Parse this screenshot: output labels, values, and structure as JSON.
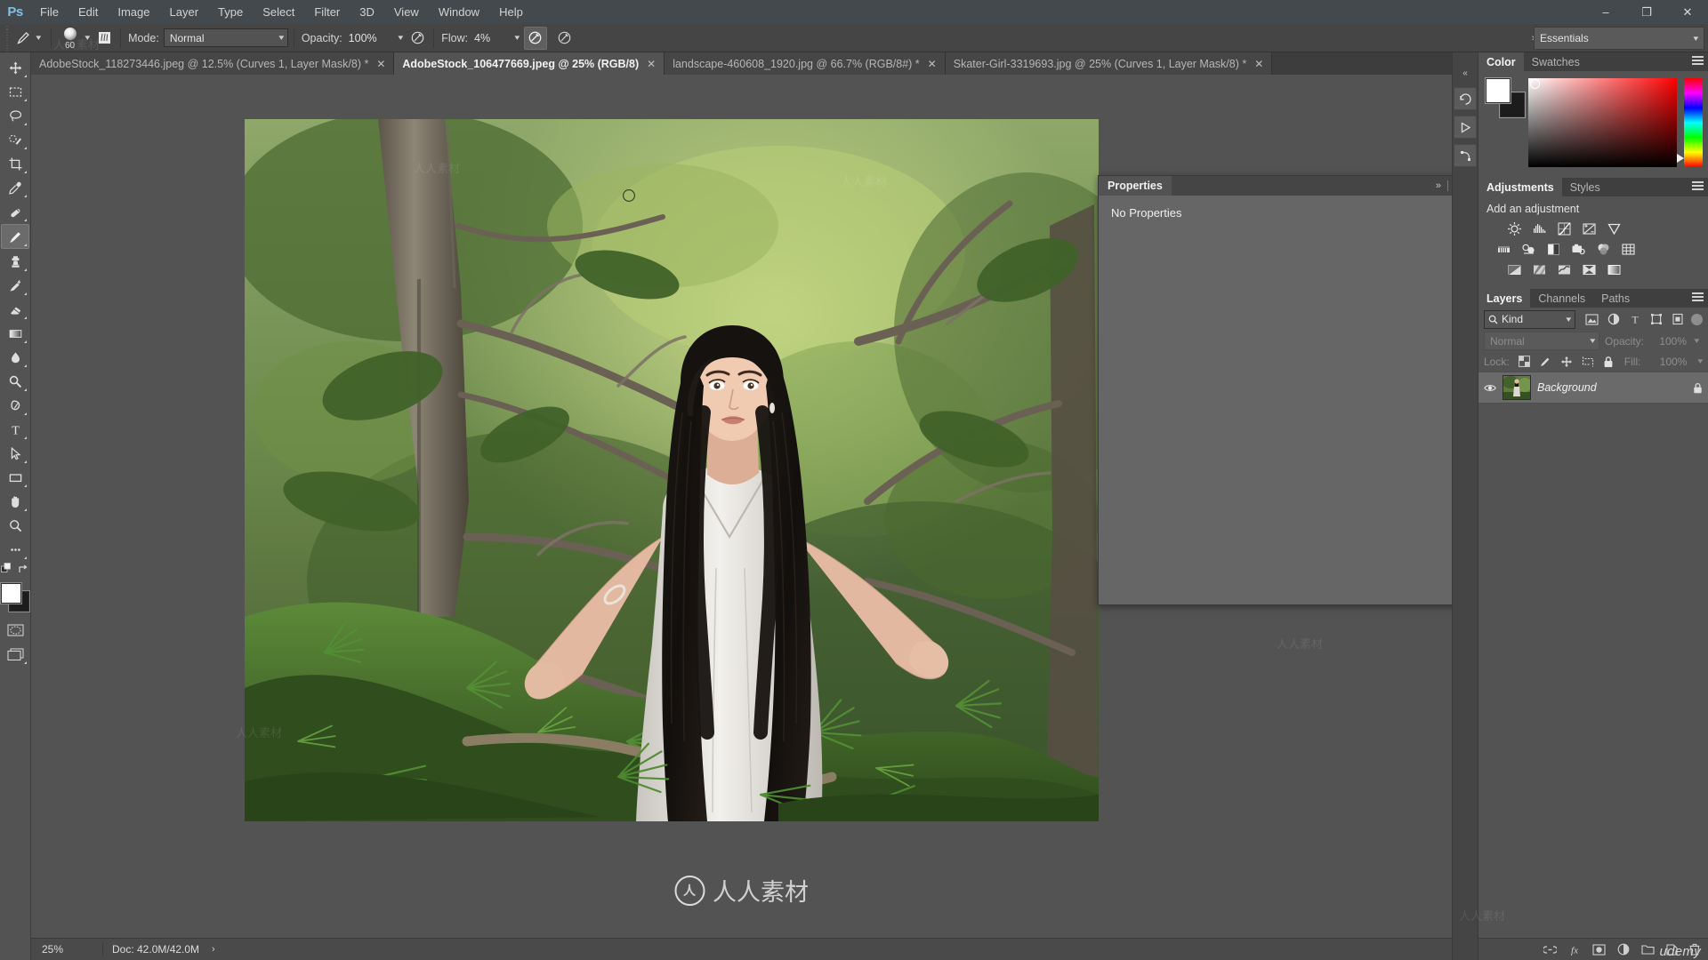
{
  "app": {
    "name": "Adobe Photoshop",
    "logo_text": "Ps"
  },
  "menubar": {
    "items": [
      {
        "label": "File"
      },
      {
        "label": "Edit"
      },
      {
        "label": "Image"
      },
      {
        "label": "Layer"
      },
      {
        "label": "Type"
      },
      {
        "label": "Select"
      },
      {
        "label": "Filter"
      },
      {
        "label": "3D"
      },
      {
        "label": "View"
      },
      {
        "label": "Window"
      },
      {
        "label": "Help"
      }
    ],
    "window_controls": {
      "minimize": "–",
      "maximize": "❐",
      "close": "✕"
    }
  },
  "options_bar": {
    "tool": "brush-tool",
    "brush_size": "60",
    "mode_label": "Mode:",
    "mode_value": "Normal",
    "opacity_label": "Opacity:",
    "opacity_value": "100%",
    "flow_label": "Flow:",
    "flow_value": "4%",
    "airbrush_icon": "airbrush-icon",
    "smoothing_icon": "tablet-pressure-icon",
    "workspace": "Essentials",
    "expand_chevrons": "»"
  },
  "document_tabs": [
    {
      "label": "AdobeStock_118273446.jpeg @ 12.5% (Curves 1, Layer Mask/8) *",
      "active": false,
      "close": "✕"
    },
    {
      "label": "AdobeStock_106477669.jpeg @ 25% (RGB/8)",
      "active": true,
      "close": "✕"
    },
    {
      "label": "landscape-460608_1920.jpg @ 66.7% (RGB/8#) *",
      "active": false,
      "close": "✕"
    },
    {
      "label": "Skater-Girl-3319693.jpg @ 25% (Curves 1, Layer Mask/8) *",
      "active": false,
      "close": "✕"
    }
  ],
  "toolbar": {
    "tools": [
      {
        "name": "move-tool",
        "selected": false
      },
      {
        "name": "rectangular-marquee-tool",
        "selected": false
      },
      {
        "name": "lasso-tool",
        "selected": false
      },
      {
        "name": "quick-selection-tool",
        "selected": false
      },
      {
        "name": "crop-tool",
        "selected": false
      },
      {
        "name": "eyedropper-tool",
        "selected": false
      },
      {
        "name": "spot-healing-brush-tool",
        "selected": false
      },
      {
        "name": "brush-tool",
        "selected": true
      },
      {
        "name": "clone-stamp-tool",
        "selected": false
      },
      {
        "name": "history-brush-tool",
        "selected": false
      },
      {
        "name": "eraser-tool",
        "selected": false
      },
      {
        "name": "gradient-tool",
        "selected": false
      },
      {
        "name": "blur-tool",
        "selected": false
      },
      {
        "name": "dodge-tool",
        "selected": false
      },
      {
        "name": "pen-tool",
        "selected": false
      },
      {
        "name": "horizontal-type-tool",
        "selected": false
      },
      {
        "name": "path-selection-tool",
        "selected": false
      },
      {
        "name": "rectangle-tool",
        "selected": false
      },
      {
        "name": "hand-tool",
        "selected": false
      },
      {
        "name": "zoom-tool",
        "selected": false
      },
      {
        "name": "edit-toolbar-tool",
        "selected": false
      }
    ],
    "foreground_color": "#ffffff",
    "background_color": "#1d1d1d",
    "quick_mask_icon": "quick-mask-icon",
    "screen_mode_icon": "screen-mode-icon"
  },
  "properties_panel": {
    "tab_label": "Properties",
    "body_text": "No Properties",
    "collapse_icon": "»",
    "menu_icon": "panel-menu-icon"
  },
  "icon_dock": {
    "buttons": [
      {
        "name": "history-dock-icon"
      },
      {
        "name": "actions-dock-icon"
      },
      {
        "name": "paths-dock-icon"
      }
    ],
    "expand_icon": "«"
  },
  "color_panel": {
    "tabs": [
      {
        "label": "Color",
        "active": true
      },
      {
        "label": "Swatches",
        "active": false
      }
    ],
    "foreground_color": "#ffffff",
    "background_color": "#1c1c1c",
    "menu_icon": "panel-menu-icon"
  },
  "adjustments_panel": {
    "tabs": [
      {
        "label": "Adjustments",
        "active": true
      },
      {
        "label": "Styles",
        "active": false
      }
    ],
    "heading": "Add an adjustment",
    "row1": [
      {
        "name": "brightness-contrast-icon"
      },
      {
        "name": "levels-icon"
      },
      {
        "name": "curves-icon"
      },
      {
        "name": "exposure-icon"
      },
      {
        "name": "vibrance-icon"
      }
    ],
    "row2": [
      {
        "name": "hue-saturation-icon"
      },
      {
        "name": "color-balance-icon"
      },
      {
        "name": "black-white-icon"
      },
      {
        "name": "photo-filter-icon"
      },
      {
        "name": "channel-mixer-icon"
      },
      {
        "name": "color-lookup-icon"
      }
    ],
    "row3": [
      {
        "name": "invert-icon"
      },
      {
        "name": "posterize-icon"
      },
      {
        "name": "threshold-icon"
      },
      {
        "name": "selective-color-icon"
      },
      {
        "name": "gradient-map-icon"
      }
    ],
    "menu_icon": "panel-menu-icon"
  },
  "layers_panel": {
    "tabs": [
      {
        "label": "Layers",
        "active": true
      },
      {
        "label": "Channels",
        "active": false
      },
      {
        "label": "Paths",
        "active": false
      }
    ],
    "filter_label": "Kind",
    "filter_search_icon": "search-icon",
    "filter_chevron": "⌄",
    "filter_type_icons": [
      {
        "name": "filter-pixel-icon"
      },
      {
        "name": "filter-adjustment-icon"
      },
      {
        "name": "filter-type-icon"
      },
      {
        "name": "filter-shape-icon"
      },
      {
        "name": "filter-smart-object-icon"
      }
    ],
    "filter_toggle": "filter-enable-toggle",
    "blend_mode": "Normal",
    "blend_chevron": "⌄",
    "opacity_label": "Opacity:",
    "opacity_value": "100%",
    "lock_label": "Lock:",
    "lock_icons": [
      {
        "name": "lock-transparent-pixels-icon"
      },
      {
        "name": "lock-image-pixels-icon"
      },
      {
        "name": "lock-position-icon"
      },
      {
        "name": "lock-artboard-nesting-icon"
      },
      {
        "name": "lock-all-icon"
      }
    ],
    "fill_label": "Fill:",
    "fill_value": "100%",
    "layers": [
      {
        "name": "Background",
        "visible": true,
        "locked": true,
        "visibility_icon": "eye-icon",
        "lock_icon": "lock-icon"
      }
    ],
    "footer_buttons": [
      {
        "name": "link-layers-icon"
      },
      {
        "name": "layer-style-icon"
      },
      {
        "name": "add-layer-mask-icon"
      },
      {
        "name": "new-fill-adjustment-layer-icon"
      },
      {
        "name": "new-group-icon"
      },
      {
        "name": "new-layer-icon"
      },
      {
        "name": "delete-layer-icon"
      }
    ]
  },
  "status_bar": {
    "zoom": "25%",
    "doc_info": "Doc: 42.0M/42.0M",
    "expand_arrow": "›"
  },
  "watermark": {
    "brand": "人人素材",
    "mark": "人",
    "tiles": "人人素材",
    "course_brand": "udemy"
  },
  "canvas": {
    "alt": "Woman in white dress standing among green pine branches in a forest",
    "document": "AdobeStock_106477669.jpeg",
    "zoom": "25%"
  }
}
